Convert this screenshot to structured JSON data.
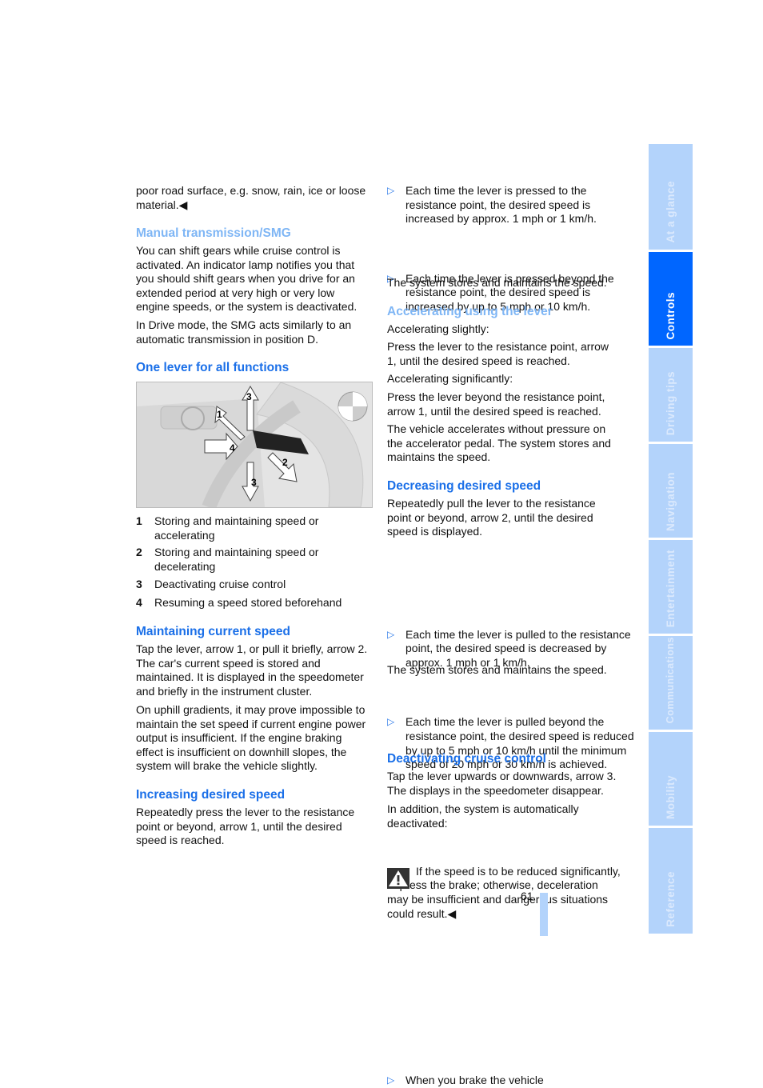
{
  "left": {
    "intro": "poor road surface, e.g. snow, rain, ice or loose material.◀",
    "manual": {
      "heading": "Manual transmission/SMG",
      "p1": "You can shift gears while cruise control is activated. An indicator lamp notifies you that you should shift gears when you drive for an extended period at very high or very low engine speeds, or the system is deactivated.",
      "p2": "In Drive mode, the SMG acts similarly to an automatic transmission in position D."
    },
    "one_lever": {
      "heading": "One lever for all functions",
      "figure_labels": [
        "1",
        "2",
        "3",
        "4",
        "3"
      ],
      "items": [
        {
          "n": "1",
          "text": "Storing and maintaining speed or accelerating"
        },
        {
          "n": "2",
          "text": "Storing and maintaining speed or decelerating"
        },
        {
          "n": "3",
          "text": "Deactivating cruise control"
        },
        {
          "n": "4",
          "text": "Resuming a speed stored beforehand"
        }
      ]
    },
    "maintaining": {
      "heading": "Maintaining current speed",
      "p1": "Tap the lever, arrow 1, or pull it briefly, arrow 2. The car's current speed is stored and maintained. It is displayed in the speedometer and briefly in the instrument cluster.",
      "p2": "On uphill gradients, it may prove impossible to maintain the set speed if current engine power output is insufficient. If the engine braking effect is insufficient on downhill slopes, the system will brake the vehicle slightly."
    },
    "increasing": {
      "heading": "Increasing desired speed",
      "p1": "Repeatedly press the lever to the resistance point or beyond, arrow 1, until the desired speed is reached."
    }
  },
  "right": {
    "inc_bullets": [
      "Each time the lever is pressed to the resistance point, the desired speed is increased by approx. 1 mph or 1 km/h.",
      "Each time the lever is pressed beyond the resistance point, the desired speed is increased by up to 5 mph or 10 km/h."
    ],
    "inc_after": "The system stores and maintains the speed.",
    "accelerating": {
      "heading": "Accelerating using the lever",
      "p1": "Accelerating slightly:",
      "p2": "Press the lever to the resistance point, arrow 1, until the desired speed is reached.",
      "p3": "Accelerating significantly:",
      "p4": "Press the lever beyond the resistance point, arrow 1, until the desired speed is reached.",
      "p5": "The vehicle accelerates without pressure on the accelerator pedal. The system stores and maintains the speed."
    },
    "decreasing": {
      "heading": "Decreasing desired speed",
      "p1": "Repeatedly pull the lever to the resistance point or beyond, arrow 2, until the desired speed is displayed.",
      "bullets": [
        "Each time the lever is pulled to the resistance point, the desired speed is decreased by approx. 1 mph or 1 km/h.",
        "Each time the lever is pulled beyond the resistance point, the desired speed is reduced by up to 5 mph or 10 km/h until the minimum speed of 20 mph or 30 km/h is achieved."
      ],
      "after": "The system stores and maintains the speed.",
      "warning": "If the speed is to be reduced significantly, depress the brake; otherwise, deceleration may be insufficient and dangerous situations could result.◀"
    },
    "deactivating": {
      "heading": "Deactivating cruise control",
      "p1": "Tap the lever upwards or downwards, arrow 3. The displays in the speedometer disappear.",
      "p2": "In addition, the system is automatically deactivated:",
      "bullets": [
        "When you brake the vehicle"
      ]
    }
  },
  "bullet_icon": "triangle-right-outline",
  "page_number": "61",
  "tabs": [
    {
      "label": "At a glance",
      "active": false
    },
    {
      "label": "Controls",
      "active": true
    },
    {
      "label": "Driving tips",
      "active": false
    },
    {
      "label": "Navigation",
      "active": false
    },
    {
      "label": "Entertainment",
      "active": false
    },
    {
      "label": "Communications",
      "active": false
    },
    {
      "label": "Mobility",
      "active": false
    },
    {
      "label": "Reference",
      "active": false
    }
  ],
  "colors": {
    "heading": "#1a6fe8",
    "heading_light": "#7fb6f5",
    "tab": "#b3d3fb",
    "tab_active": "#0066ff"
  }
}
